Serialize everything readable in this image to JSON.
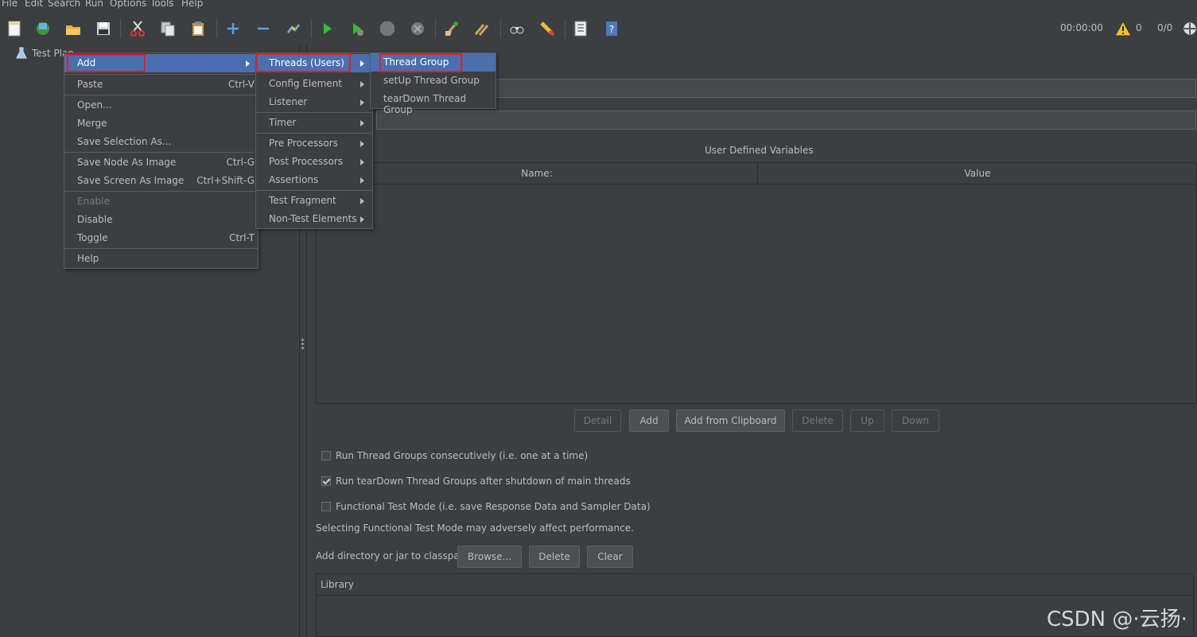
{
  "menubar": {
    "items": [
      "File",
      "Edit",
      "Search",
      "Run",
      "Options",
      "Tools",
      "Help"
    ]
  },
  "toolbar": {
    "timer": "00:00:00",
    "warnings": "0",
    "threads": "0/0"
  },
  "tree": {
    "root": "Test Plan"
  },
  "context_menu": {
    "items": [
      {
        "label": "Add",
        "accel": "",
        "submenu": true,
        "selected": true
      },
      {
        "label": "Paste",
        "accel": "Ctrl-V"
      },
      {
        "label": "Open..."
      },
      {
        "label": "Merge"
      },
      {
        "label": "Save Selection As..."
      },
      {
        "label": "Save Node As Image",
        "accel": "Ctrl-G"
      },
      {
        "label": "Save Screen As Image",
        "accel": "Ctrl+Shift-G"
      },
      {
        "label": "Enable",
        "disabled": true
      },
      {
        "label": "Disable"
      },
      {
        "label": "Toggle",
        "accel": "Ctrl-T"
      },
      {
        "label": "Help"
      }
    ]
  },
  "add_menu": {
    "items": [
      {
        "label": "Threads (Users)",
        "selected": true
      },
      {
        "label": "Config Element"
      },
      {
        "label": "Listener"
      },
      {
        "label": "Timer"
      },
      {
        "label": "Pre Processors"
      },
      {
        "label": "Post Processors"
      },
      {
        "label": "Assertions"
      },
      {
        "label": "Test Fragment"
      },
      {
        "label": "Non-Test Elements"
      }
    ]
  },
  "threads_menu": {
    "items": [
      {
        "label": "Thread Group",
        "selected": true
      },
      {
        "label": "setUp Thread Group"
      },
      {
        "label": "tearDown Thread Group"
      }
    ]
  },
  "main": {
    "udv_title": "User Defined Variables",
    "columns": {
      "name": "Name:",
      "value": "Value"
    },
    "buttons": {
      "detail": "Detail",
      "add": "Add",
      "add_clipboard": "Add from Clipboard",
      "delete": "Delete",
      "up": "Up",
      "down": "Down"
    },
    "checks": [
      {
        "label": "Run Thread Groups consecutively (i.e. one at a time)",
        "checked": false
      },
      {
        "label": "Run tearDown Thread Groups after shutdown of main threads",
        "checked": true
      },
      {
        "label": "Functional Test Mode (i.e. save Response Data and Sampler Data)",
        "checked": false
      }
    ],
    "functional_note": "Selecting Functional Test Mode may adversely affect performance.",
    "classpath_label": "Add directory or jar to classpath",
    "classpath_buttons": {
      "browse": "Browse...",
      "delete": "Delete",
      "clear": "Clear"
    },
    "library_header": "Library"
  },
  "watermark": "CSDN @·云扬·",
  "colors": {
    "highlight": "#e02020",
    "selection": "#4b6eaf",
    "background": "#3c3f41"
  }
}
